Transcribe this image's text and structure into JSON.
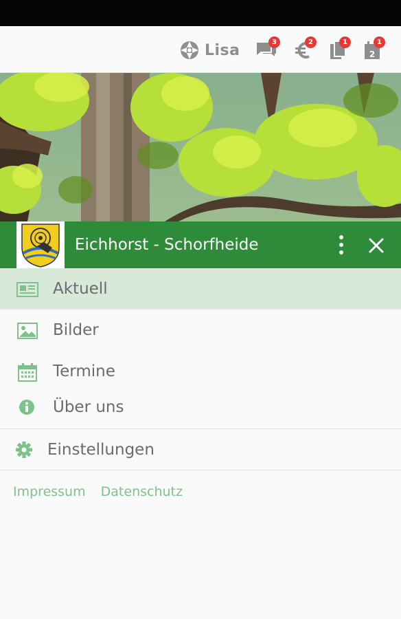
{
  "topbar": {
    "brand": "Lisa",
    "badges": {
      "messages": "3",
      "payments": "2",
      "documents": "1",
      "calendar": "1"
    }
  },
  "header": {
    "title": "Eichhorst - Schorfheide"
  },
  "menu": {
    "items": [
      {
        "label": "Aktuell",
        "icon": "newspaper-icon"
      },
      {
        "label": "Bilder",
        "icon": "image-icon"
      },
      {
        "label": "Termine",
        "icon": "calendar-icon"
      },
      {
        "label": "Über uns",
        "icon": "info-icon"
      }
    ],
    "settings": "Einstellungen"
  },
  "footer": {
    "impressum": "Impressum",
    "datenschutz": "Datenschutz"
  },
  "colors": {
    "primary": "#2e8b3a",
    "active_bg": "#d8e9da",
    "link": "#7cc28a",
    "badge": "#e53935"
  }
}
